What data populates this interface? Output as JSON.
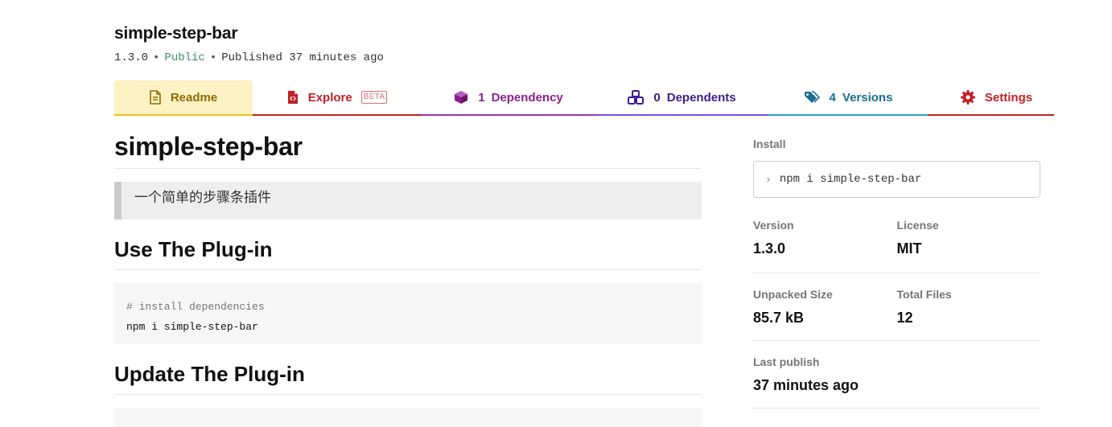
{
  "package": {
    "name": "simple-step-bar",
    "version": "1.3.0",
    "visibility": "Public",
    "published": "Published 37 minutes ago"
  },
  "tabs": {
    "readme": {
      "label": "Readme",
      "icon": "readme-file-icon"
    },
    "explore": {
      "label": "Explore",
      "badge": "BETA",
      "icon": "explore-file-icon"
    },
    "dependency": {
      "count": "1",
      "label": "Dependency",
      "icon": "cube-icon"
    },
    "dependents": {
      "count": "0",
      "label": "Dependents",
      "icon": "cubes-icon"
    },
    "versions": {
      "count": "4",
      "label": "Versions",
      "icon": "tags-icon"
    },
    "settings": {
      "label": "Settings",
      "icon": "gear-icon"
    }
  },
  "readme": {
    "title": "simple-step-bar",
    "description": "一个简单的步骤条插件",
    "section1": {
      "heading": "Use The Plug-in",
      "code_comment": "# install dependencies",
      "code_command": "npm i simple-step-bar"
    },
    "section2": {
      "heading": "Update The Plug-in"
    }
  },
  "sidebar": {
    "install_label": "Install",
    "install_command": "npm i simple-step-bar",
    "version_label": "Version",
    "version_value": "1.3.0",
    "license_label": "License",
    "license_value": "MIT",
    "unpacked_label": "Unpacked Size",
    "unpacked_value": "85.7 kB",
    "files_label": "Total Files",
    "files_value": "12",
    "last_publish_label": "Last publish",
    "last_publish_value": "37 minutes ago"
  },
  "colors": {
    "readme_tab": "#8c6d00",
    "explore_tab": "#c12127",
    "dependency_tab": "#8b1f8f",
    "dependents_tab": "#3c1c8f",
    "versions_tab": "#1a6c93",
    "settings_tab": "#c12127",
    "public": "#3f8e61"
  }
}
